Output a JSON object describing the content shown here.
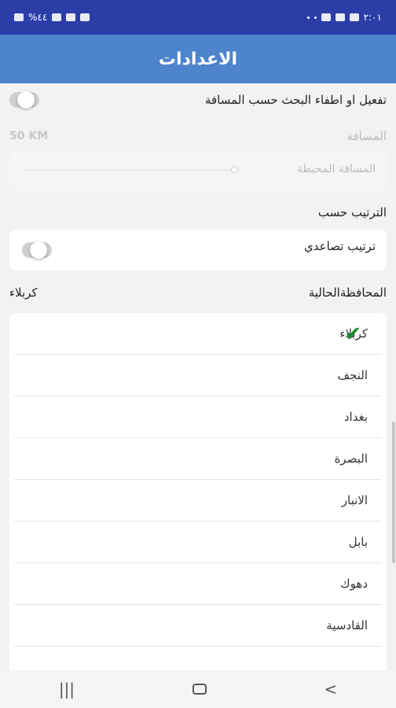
{
  "status_bar": {
    "left_text": "%٤٤",
    "time": "٢:٠١"
  },
  "header": {
    "title": "الاعدادات"
  },
  "distance_search": {
    "label": "تفعيل او اطفاء البحث حسب المسافة",
    "enabled": false
  },
  "distance": {
    "label": "المسافة",
    "value_text": "50 KM",
    "placeholder": "المسافة المحيطة"
  },
  "sort": {
    "section_label": "الترتيب حسب",
    "ascending_label": "ترتيب تصاعدي",
    "ascending_enabled": false
  },
  "governorate": {
    "label": "المحافظةالحالية",
    "current": "كربلاء",
    "options": [
      "كربلاء",
      "النجف",
      "بغداد",
      "البصرة",
      "الانبار",
      "بابل",
      "دهوك",
      "القادسية"
    ],
    "selected": "كربلاء"
  },
  "nav": {
    "recents_glyph": "|||",
    "back_glyph": "<"
  }
}
